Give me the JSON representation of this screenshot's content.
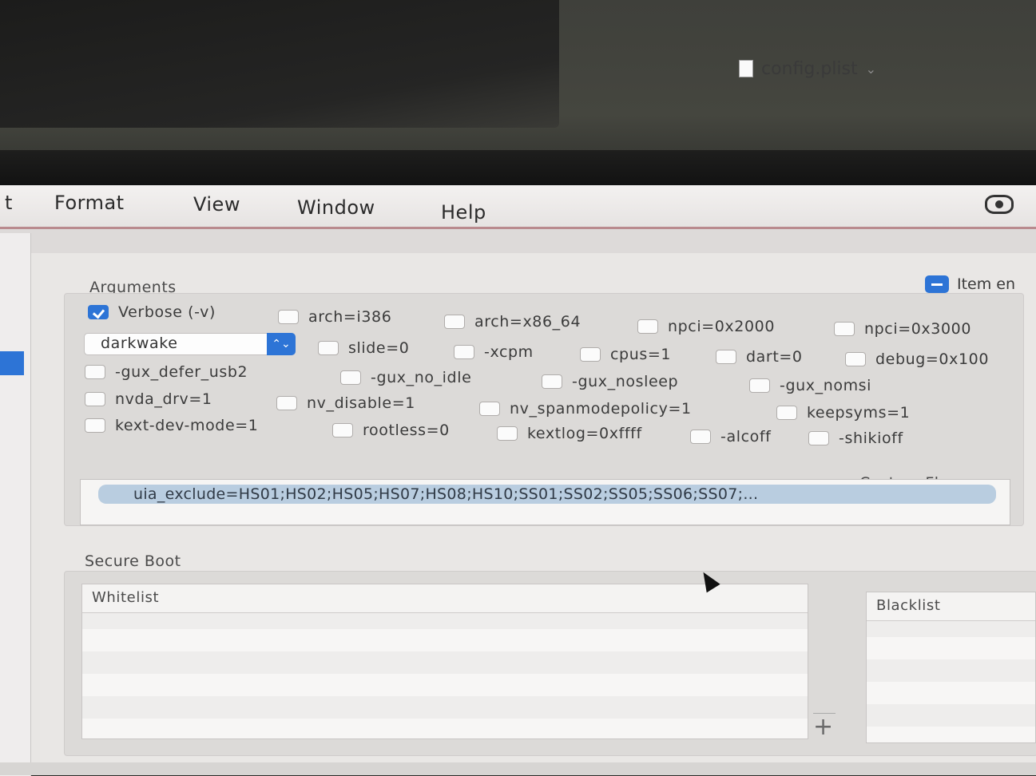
{
  "menubar": {
    "items": [
      "t",
      "Format",
      "View",
      "Window",
      "Help"
    ]
  },
  "document": {
    "filename": "config.plist"
  },
  "arguments": {
    "section_label": "Arguments",
    "item_enabled_label": "Item en",
    "boot_arg_select": "darkwake",
    "checkboxes": [
      {
        "label": "Verbose (-v)",
        "checked": true
      },
      {
        "label": "arch=i386",
        "checked": false
      },
      {
        "label": "arch=x86_64",
        "checked": false
      },
      {
        "label": "npci=0x2000",
        "checked": false
      },
      {
        "label": "npci=0x3000",
        "checked": false
      },
      {
        "label": "slide=0",
        "checked": false
      },
      {
        "label": "-xcpm",
        "checked": false
      },
      {
        "label": "cpus=1",
        "checked": false
      },
      {
        "label": "dart=0",
        "checked": false
      },
      {
        "label": "debug=0x100",
        "checked": false
      },
      {
        "label": "-gux_defer_usb2",
        "checked": false
      },
      {
        "label": "-gux_no_idle",
        "checked": false
      },
      {
        "label": "-gux_nosleep",
        "checked": false
      },
      {
        "label": "-gux_nomsi",
        "checked": false
      },
      {
        "label": "nvda_drv=1",
        "checked": false
      },
      {
        "label": "nv_disable=1",
        "checked": false
      },
      {
        "label": "nv_spanmodepolicy=1",
        "checked": false
      },
      {
        "label": "keepsyms=1",
        "checked": false
      },
      {
        "label": "kext-dev-mode=1",
        "checked": false
      },
      {
        "label": "rootless=0",
        "checked": false
      },
      {
        "label": "kextlog=0xffff",
        "checked": false
      },
      {
        "label": "-alcoff",
        "checked": false
      },
      {
        "label": "-shikioff",
        "checked": false
      }
    ],
    "custom_flags_label": "Custom Flags",
    "custom_flags_value": "uia_exclude=HS01;HS02;HS05;HS07;HS08;HS10;SS01;SS02;SS05;SS06;SS07;..."
  },
  "secure_boot": {
    "section_label": "Secure Boot",
    "whitelist_header": "Whitelist",
    "blacklist_header": "Blacklist",
    "add_button": "+"
  },
  "colors": {
    "accent": "#2d74d6",
    "menu_border": "#b98a8e"
  }
}
